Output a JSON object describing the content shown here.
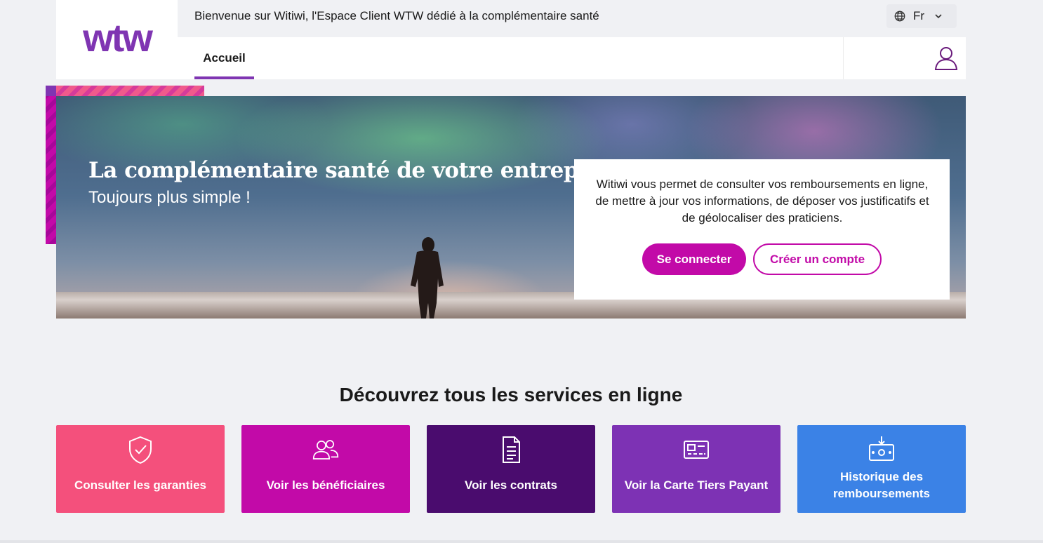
{
  "header": {
    "logo_text": "wtw",
    "welcome_text": "Bienvenue sur Witiwi, l'Espace Client WTW dédié à la complémentaire santé",
    "language": {
      "icon": "globe-icon",
      "selected": "Fr",
      "chevron_icon": "chevron-down-icon"
    },
    "nav": {
      "tabs": [
        {
          "label": "Accueil",
          "active": true
        }
      ]
    },
    "user_icon": "user-icon"
  },
  "hero": {
    "title": "La complémentaire santé de votre entreprise",
    "subtitle": "Toujours plus simple !",
    "card": {
      "text": "Witiwi vous permet de consulter vos remboursements en ligne, de mettre à jour vos informations, de déposer vos justificatifs et de géolocaliser des praticiens.",
      "login_label": "Se connecter",
      "signup_label": "Créer un compte"
    }
  },
  "services": {
    "title": "Découvrez tous les services en ligne",
    "tiles": [
      {
        "label": "Consulter les garanties",
        "icon": "shield-check-icon",
        "color": "#f4507c"
      },
      {
        "label": "Voir les bénéficiaires",
        "icon": "users-icon",
        "color": "#c20aa8"
      },
      {
        "label": "Voir les contrats",
        "icon": "document-icon",
        "color": "#4a0c6e"
      },
      {
        "label": "Voir la Carte Tiers Payant",
        "icon": "card-icon",
        "color": "#7d32b4"
      },
      {
        "label": "Historique des remboursements",
        "icon": "money-download-icon",
        "color": "#3b82e6"
      }
    ]
  },
  "colors": {
    "brand_purple": "#7f35b2",
    "magenta": "#c20aa8",
    "background": "#f0f1f4"
  }
}
